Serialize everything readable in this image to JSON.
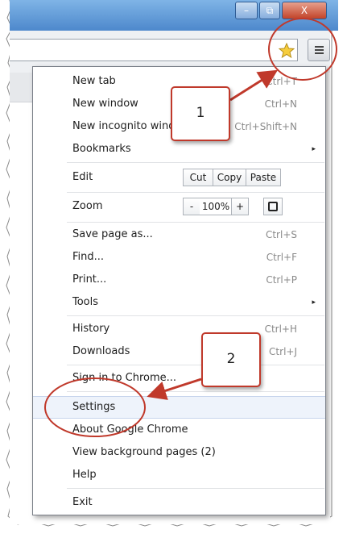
{
  "window": {
    "minimize_symbol": "–",
    "maximize_symbol": "⧉",
    "close_symbol": "X"
  },
  "toolbar": {
    "bookmark_icon": "star-icon",
    "menu_icon": "hamburger-menu-icon"
  },
  "menu": {
    "items": [
      {
        "label": "New tab",
        "shortcut": "Ctrl+T"
      },
      {
        "label": "New window",
        "shortcut": "Ctrl+N"
      },
      {
        "label": "New incognito window",
        "shortcut": "Ctrl+Shift+N"
      },
      {
        "label": "Bookmarks",
        "shortcut": "",
        "submenu": "▸"
      },
      {
        "label": "Edit"
      },
      {
        "label": "Zoom"
      },
      {
        "label": "Save page as...",
        "shortcut": "Ctrl+S"
      },
      {
        "label": "Find...",
        "shortcut": "Ctrl+F"
      },
      {
        "label": "Print...",
        "shortcut": "Ctrl+P"
      },
      {
        "label": "Tools",
        "shortcut": "",
        "submenu": "▸"
      },
      {
        "label": "History",
        "shortcut": "Ctrl+H"
      },
      {
        "label": "Downloads",
        "shortcut": "Ctrl+J"
      },
      {
        "label": "Sign in to Chrome..."
      },
      {
        "label": "Settings"
      },
      {
        "label": "About Google Chrome"
      },
      {
        "label": "View background pages (2)"
      },
      {
        "label": "Help"
      },
      {
        "label": "Exit"
      }
    ],
    "edit": {
      "cut": "Cut",
      "copy": "Copy",
      "paste": "Paste"
    },
    "zoom": {
      "minus": "-",
      "level": "100%",
      "plus": "+",
      "fullscreen_icon": "fullscreen-icon"
    }
  },
  "callouts": [
    {
      "number": "1"
    },
    {
      "number": "2"
    }
  ],
  "colors": {
    "callout_border": "#c0392b",
    "highlight_ring": "#c0392b",
    "settings_highlight": "#eef3fb"
  }
}
